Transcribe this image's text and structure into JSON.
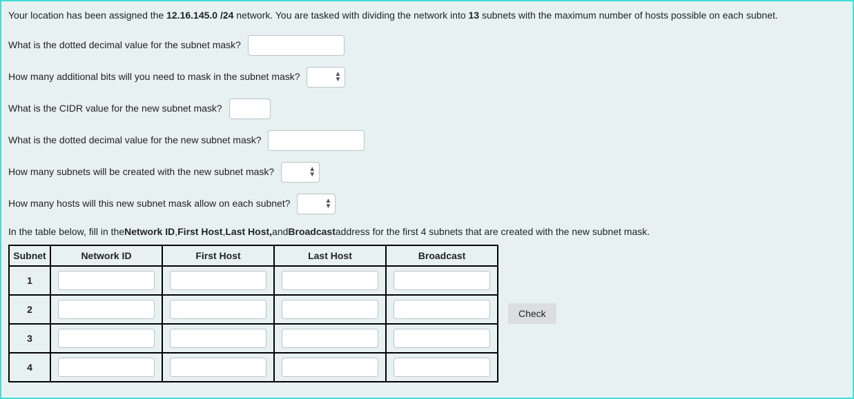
{
  "intro": {
    "prefix": "Your location has been assigned the ",
    "network": "12.16.145.0 /24",
    "mid": " network.  You are tasked with dividing the network into ",
    "subnets": "13",
    "suffix": " subnets with the maximum number of hosts possible on each subnet."
  },
  "q1": {
    "label": "What is the dotted decimal value for the subnet mask? ",
    "value": ""
  },
  "q2": {
    "label": "How many additional bits will you need to mask in the subnet mask? ",
    "value": ""
  },
  "q3": {
    "label": "What is the CIDR value for the new subnet mask? ",
    "value": ""
  },
  "q4": {
    "label": "What is the dotted decimal value for the new subnet mask? ",
    "value": ""
  },
  "q5": {
    "label": "How many subnets will be created with the new subnet mask? ",
    "value": ""
  },
  "q6": {
    "label": "How many hosts will this new subnet mask allow on each subnet? ",
    "value": ""
  },
  "tableintro": {
    "prefix": "In the table below, fill in the ",
    "b1": "Network ID",
    "s1": ", ",
    "b2": "First Host ",
    "s2": ", ",
    "b3": "Last Host,",
    "s3": " and ",
    "b4": "Broadcast",
    "suffix": " address for the first 4 subnets that are created with the new subnet mask."
  },
  "table": {
    "headers": [
      "Subnet",
      "Network ID",
      "First Host",
      "Last Host",
      "Broadcast"
    ],
    "rows": [
      {
        "num": "1",
        "network_id": "",
        "first_host": "",
        "last_host": "",
        "broadcast": ""
      },
      {
        "num": "2",
        "network_id": "",
        "first_host": "",
        "last_host": "",
        "broadcast": ""
      },
      {
        "num": "3",
        "network_id": "",
        "first_host": "",
        "last_host": "",
        "broadcast": ""
      },
      {
        "num": "4",
        "network_id": "",
        "first_host": "",
        "last_host": "",
        "broadcast": ""
      }
    ]
  },
  "check_label": "Check"
}
